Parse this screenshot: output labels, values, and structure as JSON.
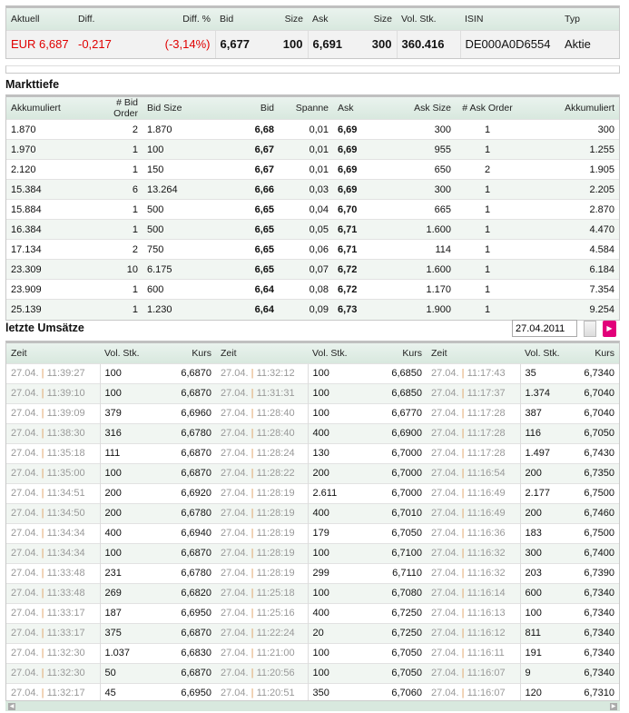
{
  "quote": {
    "headers": [
      "Aktuell",
      "Diff.",
      "Diff. %",
      "Bid",
      "Size",
      "Ask",
      "Size",
      "Vol. Stk.",
      "ISIN",
      "Typ"
    ],
    "values": [
      "EUR 6,687",
      "-0,217",
      "(-3,14%)",
      "6,677",
      "100",
      "6,691",
      "300",
      "360.416",
      "DE000A0D6554",
      "Aktie"
    ]
  },
  "markttiefe": {
    "title": "Markttiefe",
    "headers": [
      "Akkumuliert",
      "# Bid Order",
      "Bid Size",
      "Bid",
      "Spanne",
      "Ask",
      "Ask Size",
      "# Ask Order",
      "Akkumuliert"
    ],
    "rows": [
      [
        "1.870",
        "2",
        "1.870",
        "6,68",
        "0,01",
        "6,69",
        "300",
        "1",
        "300"
      ],
      [
        "1.970",
        "1",
        "100",
        "6,67",
        "0,01",
        "6,69",
        "955",
        "1",
        "1.255"
      ],
      [
        "2.120",
        "1",
        "150",
        "6,67",
        "0,01",
        "6,69",
        "650",
        "2",
        "1.905"
      ],
      [
        "15.384",
        "6",
        "13.264",
        "6,66",
        "0,03",
        "6,69",
        "300",
        "1",
        "2.205"
      ],
      [
        "15.884",
        "1",
        "500",
        "6,65",
        "0,04",
        "6,70",
        "665",
        "1",
        "2.870"
      ],
      [
        "16.384",
        "1",
        "500",
        "6,65",
        "0,05",
        "6,71",
        "1.600",
        "1",
        "4.470"
      ],
      [
        "17.134",
        "2",
        "750",
        "6,65",
        "0,06",
        "6,71",
        "114",
        "1",
        "4.584"
      ],
      [
        "23.309",
        "10",
        "6.175",
        "6,65",
        "0,07",
        "6,72",
        "1.600",
        "1",
        "6.184"
      ],
      [
        "23.909",
        "1",
        "600",
        "6,64",
        "0,08",
        "6,72",
        "1.170",
        "1",
        "7.354"
      ],
      [
        "25.139",
        "1",
        "1.230",
        "6,64",
        "0,09",
        "6,73",
        "1.900",
        "1",
        "9.254"
      ]
    ]
  },
  "umsaetze": {
    "title": "letzte Umsätze",
    "date": "27.04.2011",
    "headers": [
      "Zeit",
      "Vol. Stk.",
      "Kurs",
      "Zeit",
      "Vol. Stk.",
      "Kurs",
      "Zeit",
      "Vol. Stk.",
      "Kurs"
    ],
    "rows": [
      [
        "27.04.",
        "11:39:27",
        "100",
        "6,6870",
        "27.04.",
        "11:32:12",
        "100",
        "6,6850",
        "27.04.",
        "11:17:43",
        "35",
        "6,7340"
      ],
      [
        "27.04.",
        "11:39:10",
        "100",
        "6,6870",
        "27.04.",
        "11:31:31",
        "100",
        "6,6850",
        "27.04.",
        "11:17:37",
        "1.374",
        "6,7040"
      ],
      [
        "27.04.",
        "11:39:09",
        "379",
        "6,6960",
        "27.04.",
        "11:28:40",
        "100",
        "6,6770",
        "27.04.",
        "11:17:28",
        "387",
        "6,7040"
      ],
      [
        "27.04.",
        "11:38:30",
        "316",
        "6,6780",
        "27.04.",
        "11:28:40",
        "400",
        "6,6900",
        "27.04.",
        "11:17:28",
        "116",
        "6,7050"
      ],
      [
        "27.04.",
        "11:35:18",
        "111",
        "6,6870",
        "27.04.",
        "11:28:24",
        "130",
        "6,7000",
        "27.04.",
        "11:17:28",
        "1.497",
        "6,7430"
      ],
      [
        "27.04.",
        "11:35:00",
        "100",
        "6,6870",
        "27.04.",
        "11:28:22",
        "200",
        "6,7000",
        "27.04.",
        "11:16:54",
        "200",
        "6,7350"
      ],
      [
        "27.04.",
        "11:34:51",
        "200",
        "6,6920",
        "27.04.",
        "11:28:19",
        "2.611",
        "6,7000",
        "27.04.",
        "11:16:49",
        "2.177",
        "6,7500"
      ],
      [
        "27.04.",
        "11:34:50",
        "200",
        "6,6780",
        "27.04.",
        "11:28:19",
        "400",
        "6,7010",
        "27.04.",
        "11:16:49",
        "200",
        "6,7460"
      ],
      [
        "27.04.",
        "11:34:34",
        "400",
        "6,6940",
        "27.04.",
        "11:28:19",
        "179",
        "6,7050",
        "27.04.",
        "11:16:36",
        "183",
        "6,7500"
      ],
      [
        "27.04.",
        "11:34:34",
        "100",
        "6,6870",
        "27.04.",
        "11:28:19",
        "100",
        "6,7100",
        "27.04.",
        "11:16:32",
        "300",
        "6,7400"
      ],
      [
        "27.04.",
        "11:33:48",
        "231",
        "6,6780",
        "27.04.",
        "11:28:19",
        "299",
        "6,7110",
        "27.04.",
        "11:16:32",
        "203",
        "6,7390"
      ],
      [
        "27.04.",
        "11:33:48",
        "269",
        "6,6820",
        "27.04.",
        "11:25:18",
        "100",
        "6,7080",
        "27.04.",
        "11:16:14",
        "600",
        "6,7340"
      ],
      [
        "27.04.",
        "11:33:17",
        "187",
        "6,6950",
        "27.04.",
        "11:25:16",
        "400",
        "6,7250",
        "27.04.",
        "11:16:13",
        "100",
        "6,7340"
      ],
      [
        "27.04.",
        "11:33:17",
        "375",
        "6,6870",
        "27.04.",
        "11:22:24",
        "20",
        "6,7250",
        "27.04.",
        "11:16:12",
        "811",
        "6,7340"
      ],
      [
        "27.04.",
        "11:32:30",
        "1.037",
        "6,6830",
        "27.04.",
        "11:21:00",
        "100",
        "6,7050",
        "27.04.",
        "11:16:11",
        "191",
        "6,7340"
      ],
      [
        "27.04.",
        "11:32:30",
        "50",
        "6,6870",
        "27.04.",
        "11:20:56",
        "100",
        "6,7050",
        "27.04.",
        "11:16:07",
        "9",
        "6,7340"
      ],
      [
        "27.04.",
        "11:32:17",
        "45",
        "6,6950",
        "27.04.",
        "11:20:51",
        "350",
        "6,7060",
        "27.04.",
        "11:16:07",
        "120",
        "6,7310"
      ]
    ]
  },
  "icons": {
    "calendar": "calendar-icon",
    "go": "arrow-right-icon"
  },
  "colors": {
    "negative": "#e00000",
    "accent": "#e2007a"
  }
}
